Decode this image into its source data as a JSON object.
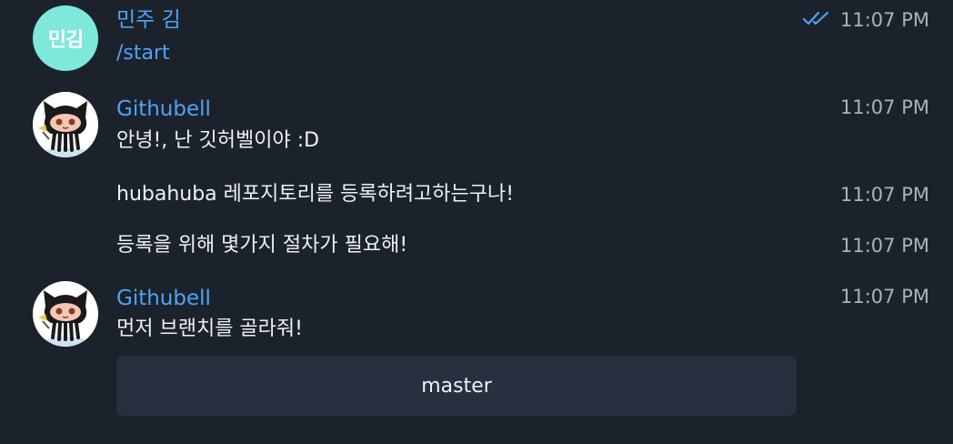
{
  "messages": [
    {
      "sender": "민주 김",
      "avatar_initials": "민김",
      "avatar_color": "#7ee8db",
      "text": "/start",
      "time": "11:07 PM",
      "read_status_icon": "double-check-icon"
    },
    {
      "sender": "Githubell",
      "avatar_icon": "octocat-avatar",
      "text": "안녕!, 난 깃허벨이야 :D",
      "time": "11:07 PM"
    },
    {
      "text": "hubahuba 레포지토리를 등록하려고하는구나!",
      "time": "11:07 PM"
    },
    {
      "text": "등록을 위해 몇가지 절차가 필요해!",
      "time": "11:07 PM"
    },
    {
      "sender": "Githubell",
      "avatar_icon": "octocat-avatar",
      "text": "먼저 브랜치를 골라줘!",
      "time": "11:07 PM"
    }
  ],
  "inline_keyboard": {
    "buttons": [
      "master"
    ]
  },
  "colors": {
    "background": "#1c222b",
    "accent": "#4ea4f6",
    "timestamp": "#a9b2bd",
    "button_bg": "#26303e"
  }
}
